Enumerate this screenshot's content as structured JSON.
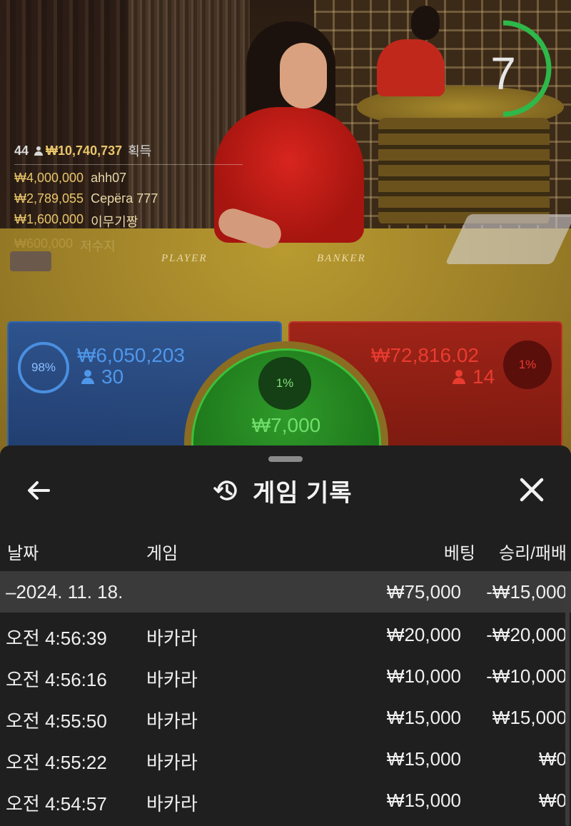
{
  "live": {
    "countdown": "7",
    "table_labels": {
      "player": "PLAYER",
      "banker": "BANKER"
    },
    "winners": {
      "count": "44",
      "total": "₩10,740,737",
      "label": "획득",
      "list": [
        {
          "amount": "₩4,000,000",
          "name": "ahh07"
        },
        {
          "amount": "₩2,789,055",
          "name": "Серёга 777"
        },
        {
          "amount": "₩1,600,000",
          "name": "이무기짱"
        },
        {
          "amount": "₩600,000",
          "name": "저수지"
        }
      ]
    },
    "player": {
      "percent": "98%",
      "amount": "₩6,050,203",
      "count": "30",
      "color": "#2f66b3"
    },
    "banker": {
      "percent": "1%",
      "amount": "₩72,816.02",
      "count": "14",
      "color": "#c0302a"
    },
    "tie": {
      "percent": "1%",
      "amount": "₩7,000",
      "color": "#1f7a1c"
    }
  },
  "history": {
    "title": "게임 기록",
    "icons": {
      "back": "arrow-left-icon",
      "history": "history-icon",
      "close": "close-icon"
    },
    "columns": {
      "date": "날짜",
      "game": "게임",
      "bet": "베팅",
      "winloss": "승리/패배"
    },
    "group": {
      "date": "–2024. 11. 18.",
      "bet": "₩75,000",
      "winloss": "-₩15,000"
    },
    "rows": [
      {
        "time": "오전 4:56:39",
        "game": "바카라",
        "bet": "₩20,000",
        "winloss": "-₩20,000"
      },
      {
        "time": "오전 4:56:16",
        "game": "바카라",
        "bet": "₩10,000",
        "winloss": "-₩10,000"
      },
      {
        "time": "오전 4:55:50",
        "game": "바카라",
        "bet": "₩15,000",
        "winloss": "₩15,000"
      },
      {
        "time": "오전 4:55:22",
        "game": "바카라",
        "bet": "₩15,000",
        "winloss": "₩0"
      },
      {
        "time": "오전 4:54:57",
        "game": "바카라",
        "bet": "₩15,000",
        "winloss": "₩0"
      }
    ]
  }
}
